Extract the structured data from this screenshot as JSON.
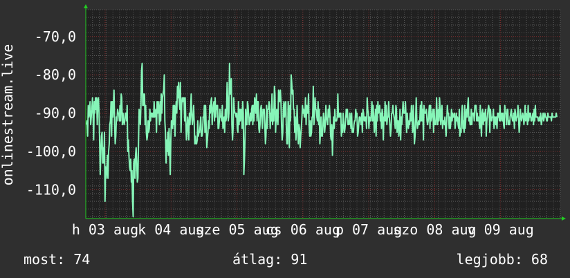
{
  "stats": {
    "now_label": "most:",
    "now_value": "74",
    "avg_label": "átlag:",
    "avg_value": "91",
    "best_label": "legjobb:",
    "best_value": "68"
  },
  "colors": {
    "background": "#2f2f2f",
    "plot_background": "#202020",
    "line": "#86f5b8",
    "grid_major": "#8a2d2d",
    "grid_minor": "#5a5a5a",
    "axis_arrow": "#22cc22"
  },
  "chart_data": {
    "type": "line",
    "ylabel": "onlinestream.live",
    "title": "",
    "xlabel": "",
    "ylim": [
      -117.5,
      -63
    ],
    "yticks": [
      -70,
      -80,
      -90,
      -100,
      -110
    ],
    "ytick_labels": [
      "-70,0",
      "-80,0",
      "-90,0",
      "-100,0",
      "-110,0"
    ],
    "xtick_labels": [
      "h 03 aug",
      "k 04 aug",
      "sze 05 aug",
      "cs 06 aug",
      "p 07 aug",
      "szo 08 aug",
      "v 09 aug"
    ],
    "grid": true,
    "series": [
      {
        "values": [
          -93,
          -92,
          -96,
          -88,
          -91,
          -90,
          -87,
          -93,
          -91,
          -89,
          -86,
          -90,
          -97,
          -87,
          -90,
          -86,
          -89,
          -86,
          -93,
          -87,
          -86,
          -90,
          -97,
          -106,
          -100,
          -96,
          -95,
          -103,
          -99,
          -103,
          -95,
          -113,
          -104,
          -107,
          -105,
          -101,
          -107,
          -100,
          -98,
          -93,
          -92,
          -87,
          -96,
          -87,
          -91,
          -88,
          -84,
          -93,
          -98,
          -96,
          -91,
          -92,
          -89,
          -90,
          -90,
          -92,
          -88,
          -92,
          -85,
          -86,
          -93,
          -90,
          -92,
          -93,
          -92,
          -90,
          -90,
          -92,
          -88,
          -100,
          -97,
          -101,
          -104,
          -105,
          -102,
          -108,
          -105,
          -113,
          -117,
          -103,
          -102,
          -107,
          -101,
          -99,
          -103,
          -108,
          -107,
          -97,
          -89,
          -90,
          -93,
          -88,
          -79,
          -77,
          -88,
          -85,
          -88,
          -85,
          -93,
          -88,
          -95,
          -97,
          -96,
          -92,
          -95,
          -94,
          -89,
          -92,
          -90,
          -90,
          -91,
          -90,
          -91,
          -87,
          -91,
          -90,
          -89,
          -95,
          -87,
          -90,
          -87,
          -89,
          -93,
          -87,
          -92,
          -85,
          -90,
          -86,
          -85,
          -84,
          -80,
          -92,
          -95,
          -103,
          -97,
          -100,
          -95,
          -101,
          -94,
          -100,
          -106,
          -97,
          -92,
          -92,
          -94,
          -88,
          -93,
          -88,
          -96,
          -89,
          -87,
          -90,
          -83,
          -86,
          -82,
          -87,
          -89,
          -82,
          -95,
          -88,
          -86,
          -87,
          -86,
          -86,
          -92,
          -86,
          -92,
          -97,
          -95,
          -91,
          -93,
          -97,
          -90,
          -93,
          -89,
          -85,
          -91,
          -93,
          -91,
          -88,
          -92,
          -98,
          -96,
          -98,
          -98,
          -97,
          -92,
          -96,
          -95,
          -95,
          -93,
          -91,
          -96,
          -96,
          -95,
          -91,
          -91,
          -88,
          -95,
          -88,
          -93,
          -99,
          -97,
          -95,
          -92,
          -94,
          -88,
          -90,
          -87,
          -86,
          -93,
          -90,
          -88,
          -87,
          -92,
          -86,
          -91,
          -88,
          -89,
          -88,
          -94,
          -94,
          -92,
          -89,
          -91,
          -91,
          -92,
          -88,
          -94,
          -93,
          -91,
          -95,
          -89,
          -92,
          -91,
          -82,
          -86,
          -92,
          -90,
          -77,
          -85,
          -85,
          -81,
          -93,
          -97,
          -94,
          -86,
          -89,
          -90,
          -90,
          -91,
          -90,
          -94,
          -95,
          -87,
          -93,
          -89,
          -92,
          -89,
          -89,
          -94,
          -87,
          -90,
          -106,
          -102,
          -96,
          -89,
          -93,
          -93,
          -87,
          -88,
          -91,
          -93,
          -92,
          -90,
          -92,
          -89,
          -88,
          -93,
          -88,
          -92,
          -86,
          -87,
          -90,
          -85,
          -92,
          -87,
          -87,
          -94,
          -95,
          -93,
          -89,
          -88,
          -91,
          -94,
          -89,
          -90,
          -89,
          -93,
          -98,
          -96,
          -88,
          -94,
          -89,
          -89,
          -87,
          -88,
          -94,
          -90,
          -92,
          -85,
          -93,
          -89,
          -92,
          -83,
          -85,
          -95,
          -91,
          -89,
          -92,
          -93,
          -84,
          -85,
          -87,
          -84,
          -87,
          -93,
          -97,
          -95,
          -89,
          -87,
          -91,
          -88,
          -87,
          -94,
          -98,
          -98,
          -87,
          -90,
          -99,
          -88,
          -92,
          -80,
          -82,
          -85,
          -84,
          -89,
          -89,
          -95,
          -91,
          -97,
          -94,
          -88,
          -93,
          -98,
          -93,
          -94,
          -99,
          -96,
          -94,
          -91,
          -88,
          -90,
          -89,
          -91,
          -91,
          -86,
          -93,
          -88,
          -90,
          -90,
          -85,
          -93,
          -96,
          -92,
          -96,
          -95,
          -91,
          -91,
          -83,
          -93,
          -91,
          -86,
          -89,
          -89,
          -91,
          -92,
          -87,
          -93,
          -89,
          -98,
          -95,
          -91,
          -96,
          -96,
          -94,
          -90,
          -92,
          -95,
          -93,
          -88,
          -91,
          -92,
          -93,
          -89,
          -91,
          -88,
          -91,
          -96,
          -97,
          -93,
          -101,
          -96,
          -91,
          -94,
          -89,
          -92,
          -92,
          -92,
          -91,
          -85,
          -91,
          -91,
          -90,
          -91,
          -90,
          -96,
          -93,
          -95,
          -90,
          -93,
          -95,
          -94,
          -92,
          -89,
          -91,
          -89,
          -93,
          -92,
          -93,
          -90,
          -92,
          -94,
          -90,
          -95,
          -94,
          -95,
          -93,
          -92,
          -92,
          -89,
          -91,
          -90,
          -96,
          -95,
          -93,
          -91,
          -91,
          -92,
          -93,
          -90,
          -95,
          -89,
          -90,
          -92,
          -91,
          -92,
          -91,
          -94,
          -86,
          -89,
          -90,
          -94,
          -91,
          -92,
          -92,
          -90,
          -87,
          -92,
          -88,
          -91,
          -95,
          -92,
          -89,
          -96,
          -88,
          -92,
          -87,
          -90,
          -89,
          -88,
          -92,
          -90,
          -94,
          -89,
          -90,
          -97,
          -91,
          -92,
          -87,
          -92,
          -88,
          -93,
          -91,
          -91,
          -87,
          -91,
          -93,
          -96,
          -94,
          -90,
          -90,
          -88,
          -90,
          -91,
          -92,
          -94,
          -88,
          -89,
          -95,
          -92,
          -92,
          -96,
          -94,
          -89,
          -97,
          -91,
          -93,
          -90,
          -87,
          -90,
          -90,
          -90,
          -87,
          -91,
          -95,
          -90,
          -93,
          -94,
          -92,
          -93,
          -90,
          -92,
          -88,
          -91,
          -95,
          -88,
          -92,
          -98,
          -96,
          -92,
          -86,
          -92,
          -94,
          -93,
          -92,
          -93,
          -92,
          -88,
          -92,
          -87,
          -92,
          -89,
          -97,
          -88,
          -90,
          -90,
          -90,
          -89,
          -92,
          -93,
          -92,
          -90,
          -88,
          -94,
          -88,
          -92,
          -91,
          -90,
          -89,
          -95,
          -89,
          -93,
          -92,
          -93,
          -86,
          -91,
          -93,
          -89,
          -92,
          -86,
          -89,
          -93,
          -90,
          -88,
          -94,
          -92,
          -92,
          -93,
          -91,
          -94,
          -96,
          -92,
          -88,
          -90,
          -90,
          -94,
          -91,
          -94,
          -92,
          -89,
          -92,
          -90,
          -91,
          -91,
          -90,
          -94,
          -92,
          -90,
          -92,
          -91,
          -93,
          -94,
          -89,
          -96,
          -94,
          -95,
          -90,
          -88,
          -94,
          -92,
          -95,
          -88,
          -94,
          -91,
          -89,
          -91,
          -88,
          -86,
          -92,
          -91,
          -93,
          -93,
          -89,
          -93,
          -90,
          -90,
          -90,
          -92,
          -88,
          -88,
          -88,
          -92,
          -90,
          -92,
          -91,
          -92,
          -94,
          -88,
          -92,
          -96,
          -90,
          -89,
          -93,
          -90,
          -92,
          -90,
          -89,
          -96,
          -92,
          -91,
          -89,
          -88,
          -89,
          -95,
          -89,
          -91,
          -92,
          -91,
          -91,
          -89,
          -94,
          -91,
          -91,
          -93,
          -91,
          -94,
          -90,
          -91,
          -90,
          -92,
          -88,
          -92,
          -91,
          -90,
          -92,
          -90,
          -93,
          -94,
          -88,
          -90,
          -90,
          -93,
          -89,
          -89,
          -93,
          -92,
          -93,
          -91,
          -90,
          -89,
          -91,
          -92,
          -92,
          -90,
          -94,
          -89,
          -90,
          -92,
          -91,
          -91,
          -88,
          -91,
          -95,
          -93,
          -89,
          -91,
          -92,
          -91,
          -90,
          -91,
          -93,
          -91,
          -88,
          -92,
          -90,
          -91,
          -93,
          -88,
          -92,
          -90,
          -91,
          -90,
          -92,
          -92,
          -91,
          -90,
          -93,
          -89,
          -92,
          -88,
          -91,
          -91,
          -91,
          -91,
          -92,
          -92,
          -91,
          -92,
          -90,
          -93,
          -92,
          -91,
          -90,
          -92,
          -91,
          -90,
          -91,
          -91,
          -92,
          -92,
          -90,
          -91,
          -91,
          -91,
          -91,
          -91,
          -92,
          -90,
          -91,
          -91,
          -91,
          -91,
          -91,
          -91,
          -90,
          -91
        ]
      }
    ]
  }
}
